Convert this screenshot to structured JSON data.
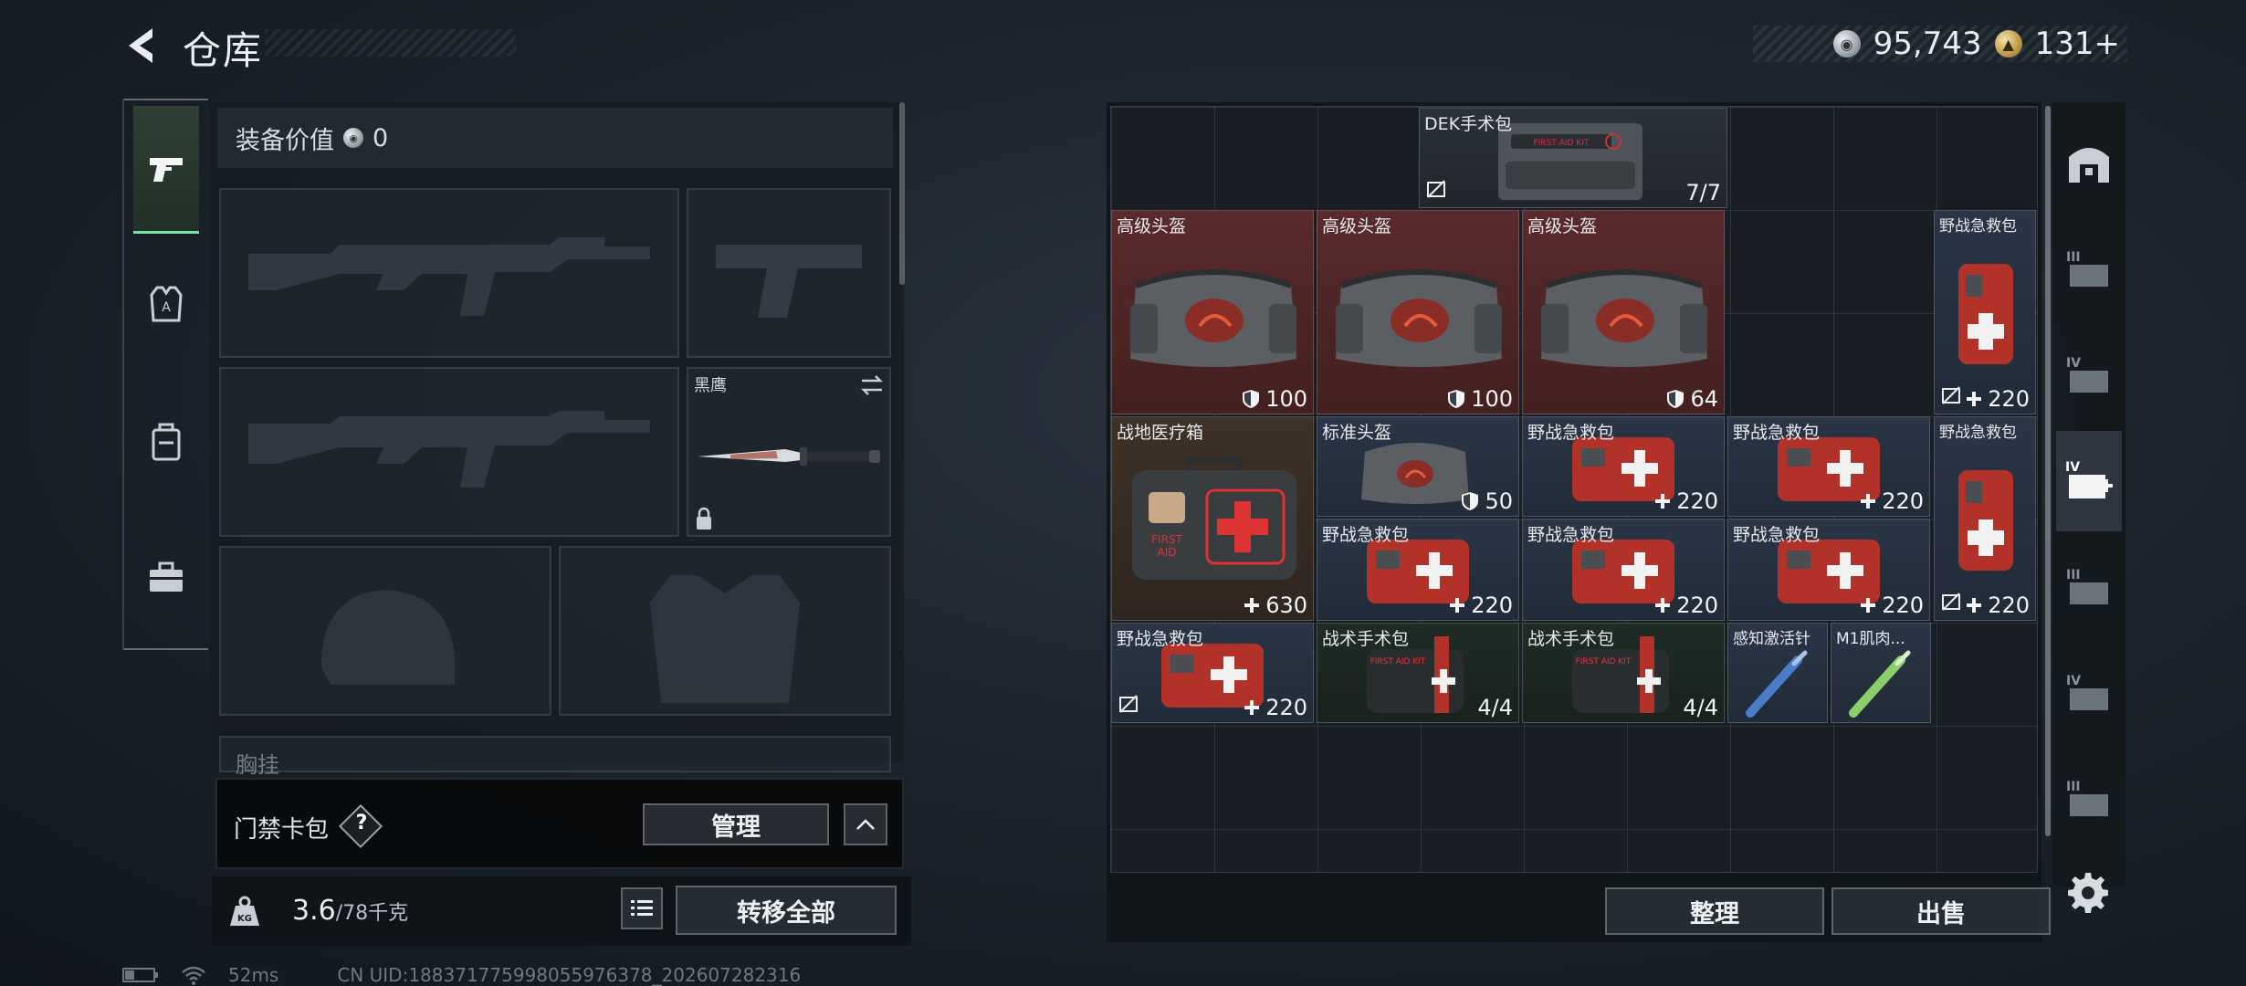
{
  "header": {
    "title": "仓库"
  },
  "currency": {
    "silver_value": "95,743",
    "gold_value": "131",
    "gold_plus": "+"
  },
  "equip": {
    "value_label": "装备价值",
    "value": "0"
  },
  "slots": {
    "knife_label": "黑鹰",
    "chest_label": "胸挂"
  },
  "keycard": {
    "label": "门禁卡包",
    "help": "?",
    "manage_label": "管理"
  },
  "weight": {
    "current": "3.6",
    "max": "/78千克"
  },
  "transfer_all_label": "转移全部",
  "items": [
    {
      "name": "DEK手术包",
      "value": "7/7"
    },
    {
      "name": "高级头盔",
      "value": "100"
    },
    {
      "name": "高级头盔",
      "value": "100"
    },
    {
      "name": "高级头盔",
      "value": "64"
    },
    {
      "name": "野战急救包",
      "value": "220"
    },
    {
      "name": "战地医疗箱",
      "value": "630"
    },
    {
      "name": "标准头盔",
      "value": "50"
    },
    {
      "name": "野战急救包",
      "value": "220"
    },
    {
      "name": "野战急救包",
      "value": "220"
    },
    {
      "name": "野战急救包",
      "value": "220"
    },
    {
      "name": "野战急救包",
      "value": "220"
    },
    {
      "name": "野战急救包",
      "value": "220"
    },
    {
      "name": "野战急救包",
      "value": "220"
    },
    {
      "name": "野战急救包",
      "value": "220"
    },
    {
      "name": "战术手术包",
      "value": "4/4"
    },
    {
      "name": "战术手术包",
      "value": "4/4"
    },
    {
      "name": "感知激活针",
      "value": ""
    },
    {
      "name": "M1肌肉...",
      "value": ""
    }
  ],
  "inventory_actions": {
    "sort_label": "整理",
    "sell_label": "出售"
  },
  "status": {
    "ping": "52ms",
    "uid": "CN UID:1883717759980559763​78_202607282316"
  },
  "colors": {
    "active_green": "#7be0a4",
    "rarity_red": "#5a2a2c",
    "rarity_blue": "#2a3546"
  }
}
